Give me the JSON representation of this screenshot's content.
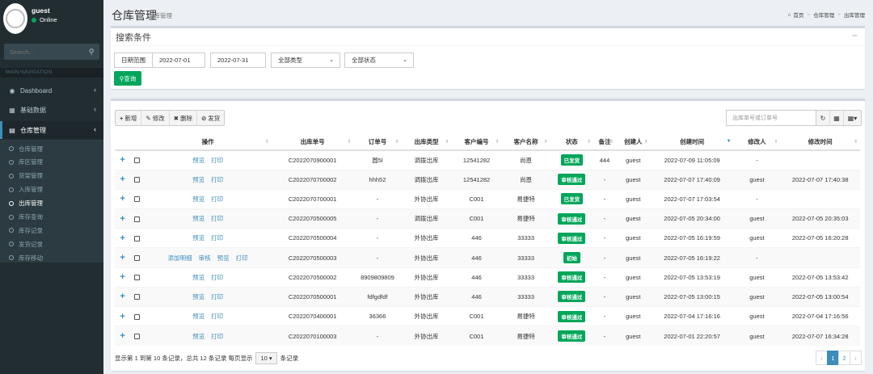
{
  "sidebar": {
    "user": {
      "name": "guest",
      "status": "Online"
    },
    "search_placeholder": "Search...",
    "nav_header": "MAIN NAVIGATION",
    "menu": [
      {
        "label": "Dashboard",
        "icon": "dashboard-icon"
      },
      {
        "label": "基础数据",
        "icon": "book-icon"
      },
      {
        "label": "仓库管理",
        "icon": "warehouse-icon"
      }
    ],
    "submenu": [
      "仓库管理",
      "库区管理",
      "货架管理",
      "入库管理",
      "出库管理",
      "库存查询",
      "库存记录",
      "发货记录",
      "库存移动"
    ],
    "active_sub": 4
  },
  "header": {
    "title": "仓库管理",
    "subtitle": "出库管理",
    "breadcrumb": [
      "首页",
      "仓库管理",
      "出库管理"
    ]
  },
  "search_panel": {
    "title": "搜索条件",
    "collapse": "−",
    "date_label": "日期范围",
    "date_from": "2022-07-01",
    "date_to": "2022-07-31",
    "type_select": "全部类型",
    "status_select": "全部状态",
    "query_button": "查询"
  },
  "toolbar": {
    "add": "新增",
    "edit": "修改",
    "delete": "删除",
    "ship": "发货",
    "search_placeholder": "出库单号或订单号"
  },
  "table": {
    "headers": [
      "操作",
      "出库单号",
      "订单号",
      "出库类型",
      "客户编号",
      "客户名称",
      "状态",
      "备注",
      "创建人",
      "创建时间",
      "修改人",
      "修改时间"
    ],
    "rows": [
      {
        "ops": [
          "预览",
          "打印"
        ],
        "no": "C2022070900001",
        "order": "圆5l",
        "type": "调拨出库",
        "cust_no": "12541282",
        "cust_name": "尚恩",
        "status": "已发货",
        "note": "444",
        "creator": "guest",
        "created": "2022-07-09 11:05:09",
        "modifier": "-",
        "modified": ""
      },
      {
        "ops": [
          "预览",
          "打印"
        ],
        "no": "C2022070700002",
        "order": "hhh52",
        "type": "调拨出库",
        "cust_no": "12541282",
        "cust_name": "尚恩",
        "status": "审核通过",
        "note": "-",
        "creator": "guest",
        "created": "2022-07-07 17:40:09",
        "modifier": "guest",
        "modified": "2022-07-07 17:40:38"
      },
      {
        "ops": [
          "预览",
          "打印"
        ],
        "no": "C2022070700001",
        "order": "-",
        "type": "外协出库",
        "cust_no": "C001",
        "cust_name": "易捷特",
        "status": "已发货",
        "note": "-",
        "creator": "guest",
        "created": "2022-07-07 17:03:54",
        "modifier": "-",
        "modified": ""
      },
      {
        "ops": [
          "预览",
          "打印"
        ],
        "no": "C2022070500005",
        "order": "-",
        "type": "调拨出库",
        "cust_no": "C001",
        "cust_name": "易捷特",
        "status": "审核通过",
        "note": "-",
        "creator": "guest",
        "created": "2022-07-05 20:34:00",
        "modifier": "guest",
        "modified": "2022-07-05 20:35:03"
      },
      {
        "ops": [
          "预览",
          "打印"
        ],
        "no": "C2022070500004",
        "order": "-",
        "type": "外协出库",
        "cust_no": "446",
        "cust_name": "33333",
        "status": "审核通过",
        "note": "-",
        "creator": "guest",
        "created": "2022-07-05 16:19:59",
        "modifier": "guest",
        "modified": "2022-07-05 16:20:28"
      },
      {
        "ops": [
          "添加明细",
          "审核",
          "预览",
          "打印"
        ],
        "no": "C2022070500003",
        "order": "-",
        "type": "外协出库",
        "cust_no": "446",
        "cust_name": "33333",
        "status": "初始",
        "note": "-",
        "creator": "guest",
        "created": "2022-07-05 16:19:22",
        "modifier": "-",
        "modified": ""
      },
      {
        "ops": [
          "预览",
          "打印"
        ],
        "no": "C2022070500002",
        "order": "8909809809",
        "type": "外协出库",
        "cust_no": "446",
        "cust_name": "33333",
        "status": "审核通过",
        "note": "-",
        "creator": "guest",
        "created": "2022-07-05 13:53:19",
        "modifier": "guest",
        "modified": "2022-07-05 13:53:42"
      },
      {
        "ops": [
          "预览",
          "打印"
        ],
        "no": "C2022070500001",
        "order": "fdfgdfdf",
        "type": "外协出库",
        "cust_no": "446",
        "cust_name": "33333",
        "status": "审核通过",
        "note": "-",
        "creator": "guest",
        "created": "2022-07-05 13:00:15",
        "modifier": "guest",
        "modified": "2022-07-05 13:00:54"
      },
      {
        "ops": [
          "预览",
          "打印"
        ],
        "no": "C2022070400001",
        "order": "36366",
        "type": "外协出库",
        "cust_no": "C001",
        "cust_name": "易捷特",
        "status": "审核通过",
        "note": "-",
        "creator": "guest",
        "created": "2022-07-04 17:16:16",
        "modifier": "guest",
        "modified": "2022-07-04 17:16:56"
      },
      {
        "ops": [
          "预览",
          "打印"
        ],
        "no": "C2022070100003",
        "order": "-",
        "type": "外协出库",
        "cust_no": "C001",
        "cust_name": "易捷特",
        "status": "审核通过",
        "note": "-",
        "creator": "guest",
        "created": "2022-07-01 22:20:57",
        "modifier": "guest",
        "modified": "2022-07-07 16:34:28"
      }
    ]
  },
  "footer": {
    "info_prefix": "显示第 1 到第 10 条记录，总共 12 条记录 每页显示",
    "page_size": "10",
    "info_suffix": "条记录",
    "pages": [
      "‹",
      "1",
      "2",
      "›"
    ],
    "current_page": "1"
  },
  "colors": {
    "sidebar": "#222d32",
    "accent": "#3c8dbc",
    "success": "#00a65a"
  }
}
